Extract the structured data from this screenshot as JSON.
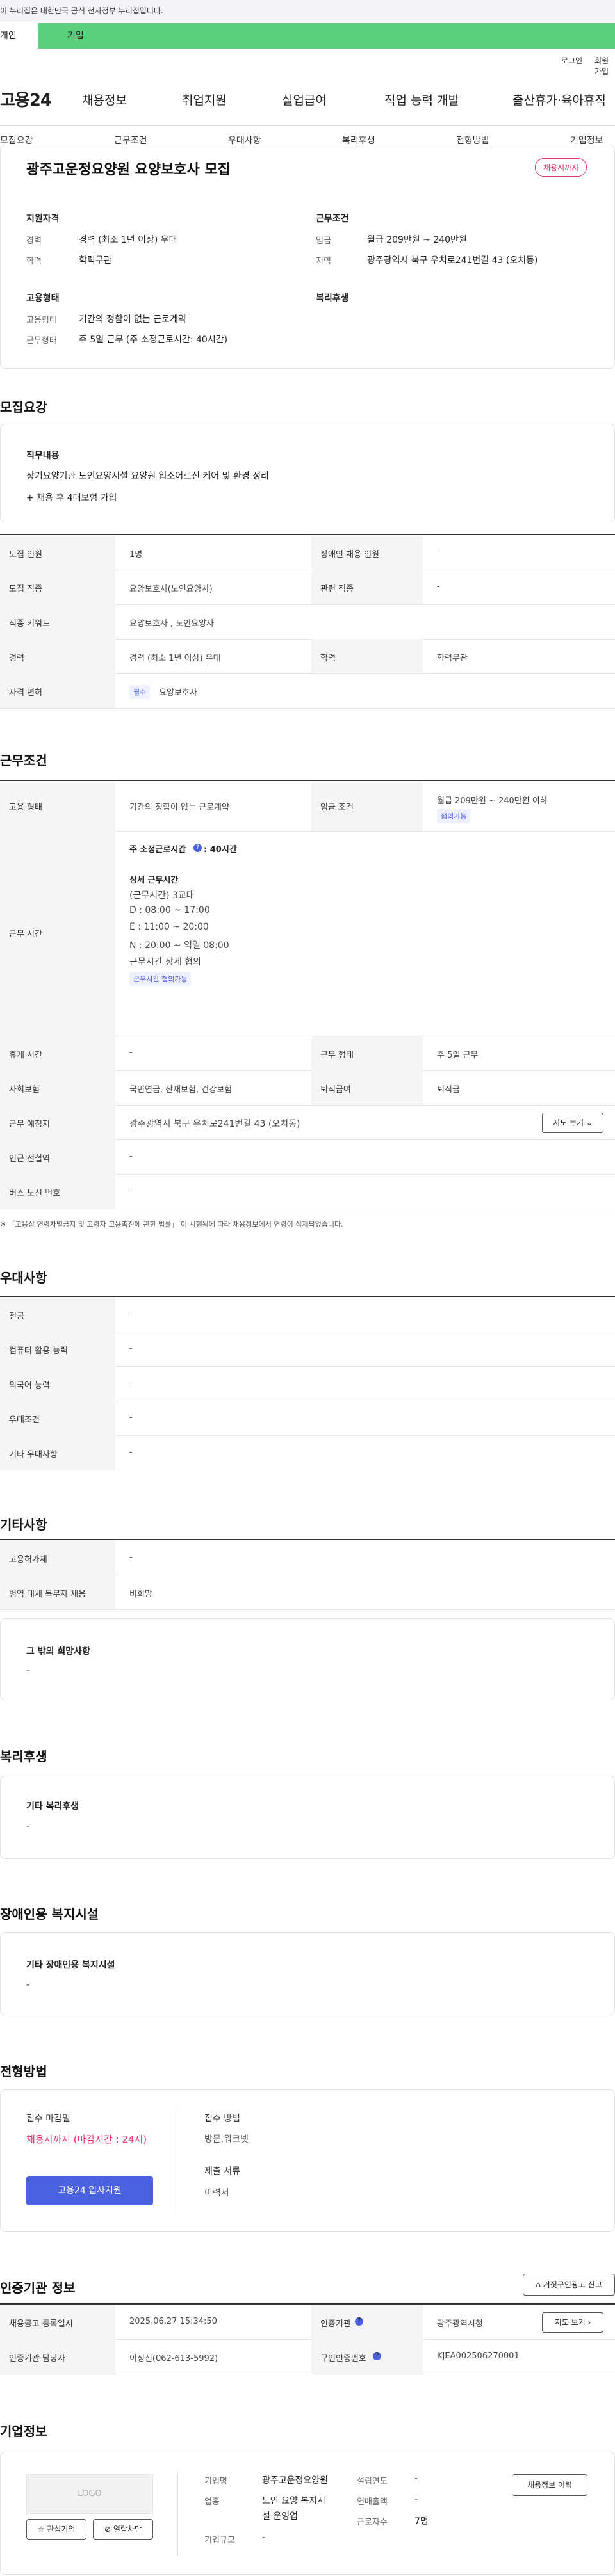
{
  "banner": {
    "text": "이 누리집은 대한민국 공식 전자정부 누리집입니다."
  },
  "user_tabs": {
    "individual": "개인",
    "business": "기업"
  },
  "top_links": {
    "login": "로그인",
    "signup": "회원가입"
  },
  "gnb": {
    "logo": "고용24",
    "menu": [
      "채용정보",
      "취업지원",
      "실업급여",
      "직업 능력 개발",
      "출산휴가·육아휴직"
    ]
  },
  "subnav": [
    "모집요강",
    "근무조건",
    "우대사항",
    "복리후생",
    "전형방법",
    "기업정보"
  ],
  "summary": {
    "title": "광주고운정요양원 요양보호사 모집",
    "badge": "채용시까지",
    "qualification": {
      "heading": "지원자격",
      "career_k": "경력",
      "career_v": "경력 (최소 1년 이상) 우대",
      "edu_k": "학력",
      "edu_v": "학력무관"
    },
    "conditions": {
      "heading": "근무조건",
      "wage_k": "임금",
      "wage_v": "월급 209만원 ~ 240만원",
      "region_k": "지역",
      "region_v": "광주광역시 북구 우치로241번길 43 (오치동)"
    },
    "employment": {
      "heading": "고용형태",
      "type_k": "고용형태",
      "type_v": "기간의 정함이 없는 근로계약",
      "hours_k": "근무형태",
      "hours_v": "주 5일 근무 (주 소정근로시간: 40시간)"
    },
    "welfare": {
      "heading": "복리후생"
    }
  },
  "recruit": {
    "section_title": "모집요강",
    "duty_heading": "직무내용",
    "duty_text": "장기요양기관 노인요양시설 요양원 입소어르신 케어 및 환경 정리",
    "duty_extra": "+ 채용 후 4대보험 가입",
    "rows": [
      {
        "k1": "모집 인원",
        "v1": "1명",
        "k2": "장애인 채용 인원",
        "v2": "-"
      },
      {
        "k1": "모집 직종",
        "v1": "요양보호사(노인요양사)",
        "k2": "관련 직종",
        "v2": "-"
      },
      {
        "k1": "직종 키워드",
        "v1": "요양보호사 , 노인요양사"
      },
      {
        "k1": "경력",
        "v1": "경력 (최소 1년 이상) 우대",
        "k2": "학력",
        "v2": "학력무관"
      },
      {
        "k1": "자격 면허",
        "chip": "필수",
        "v1": "요양보호사"
      }
    ]
  },
  "work": {
    "section_title": "근무조건",
    "emp_k": "고용 형태",
    "emp_v": "기간의 정함이 없는 근로계약",
    "wage_k": "임금 조건",
    "wage_v": "월급 209만원 ~ 240만원 이하",
    "wage_chip": "협의가능",
    "time_k": "근무 시간",
    "time_weekly_label": "주 소정근로시간",
    "time_weekly_v": ": 40시간",
    "time_detail_label": "상세 근무시간",
    "time_lines": [
      "(근무시간) 3교대",
      "D : 08:00 ~ 17:00",
      "E : 11:00 ~ 20:00",
      "N : 20:00 ~ 익일 08:00",
      "근무시간 상세 협의"
    ],
    "time_chip": "근무시간 협의가능",
    "rest_k": "휴게 시간",
    "rest_v": "-",
    "form_k": "근무 형태",
    "form_v": "주 5일 근무",
    "ins_k": "사회보험",
    "ins_v": "국민연금, 산재보험, 건강보험",
    "sev_k": "퇴직급여",
    "sev_v": "퇴직금",
    "loc_k": "근무 예정지",
    "loc_v": "광주광역시 북구 우치로241번길 43 (오치동)",
    "map_btn": "지도 보기",
    "subway_k": "인근 전철역",
    "subway_v": "-",
    "bus_k": "버스 노선 번호",
    "bus_v": "-",
    "note": "※ 「고용상 연령차별금지 및 고령자 고용촉진에 관한 법률」 이 시행됨에 따라 채용정보에서 연령이 삭제되었습니다."
  },
  "prefer": {
    "section_title": "우대사항",
    "rows": [
      {
        "k": "전공",
        "v": "-"
      },
      {
        "k": "컴퓨터 활용 능력",
        "v": "-"
      },
      {
        "k": "외국어 능력",
        "v": "-"
      },
      {
        "k": "우대조건",
        "v": "-"
      },
      {
        "k": "기타 우대사항",
        "v": "-"
      }
    ]
  },
  "etc": {
    "section_title": "기타사항",
    "rows": [
      {
        "k": "고용허가제",
        "v": "-"
      },
      {
        "k": "병역 대체 복무자 채용",
        "v": "비희망"
      }
    ],
    "other_heading": "그 밖의 희망사항",
    "other_v": "-"
  },
  "welfare": {
    "section_title": "복리후생",
    "heading": "기타 복리후생",
    "v": "-"
  },
  "disabled": {
    "section_title": "장애인용 복지시설",
    "heading": "기타 장애인용 복지시설",
    "v": "-"
  },
  "process": {
    "section_title": "전형방법",
    "deadline_k": "접수 마감일",
    "deadline_v": "채용시까지 (마감시간 : 24시)",
    "apply_btn": "고용24 입사지원",
    "method_k": "접수 방법",
    "method_v": "방문,워크넷",
    "docs_k": "제출 서류",
    "docs_v": "이력서"
  },
  "cert": {
    "section_title": "인증기관 정보",
    "report_btn": "거짓구인광고 신고",
    "reg_k": "채용공고 등록일시",
    "reg_v": "2025.06.27 15:34:50",
    "org_k": "인증기관",
    "org_v": "광주광역시청",
    "map_btn": "지도 보기",
    "manager_k": "인증기관 담당자",
    "manager_v": "이정선(062-613-5992)",
    "cert_no_k": "구인인증번호",
    "cert_no_v": "KJEA002506270001"
  },
  "company": {
    "section_title": "기업정보",
    "logo": "LOGO",
    "fav_btn": "관심기업",
    "block_btn": "열람차단",
    "history_btn": "채용정보 이력",
    "name_k": "기업명",
    "name_v": "광주고운정요양원",
    "industry_k": "업종",
    "industry_v1": "노인 요양 복지시",
    "industry_v2": "설 운영업",
    "size_k": "기업규모",
    "size_v": "-",
    "founded_k": "설립연도",
    "founded_v": "-",
    "sales_k": "연매출액",
    "sales_v": "-",
    "staff_k": "근로자수",
    "staff_v": "7명"
  }
}
